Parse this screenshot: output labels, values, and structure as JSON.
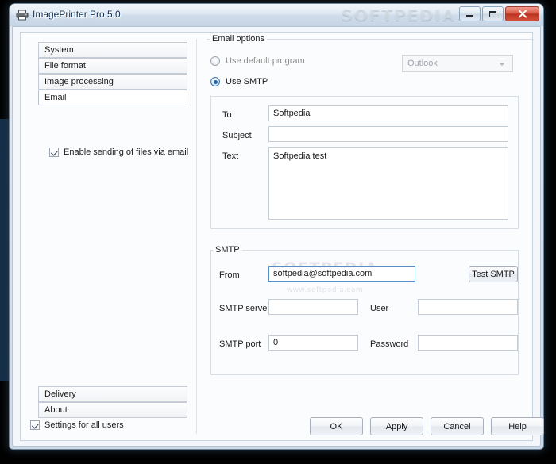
{
  "window": {
    "title": "ImagePrinter Pro 5.0",
    "icon": "printer-icon",
    "watermark": "SOFTPEDIA",
    "controls": {
      "minimize": "Minimize",
      "maximize": "Maximize",
      "close": "Close"
    }
  },
  "sidebar": {
    "items": [
      {
        "label": "System",
        "selected": false
      },
      {
        "label": "File format",
        "selected": false
      },
      {
        "label": "Image processing",
        "selected": false
      },
      {
        "label": "Email",
        "selected": true
      },
      {
        "label": "Delivery",
        "selected": false
      },
      {
        "label": "About",
        "selected": false
      }
    ],
    "enable_email": {
      "label": "Enable sending of files via email",
      "checked": true
    },
    "settings_all_users": {
      "label": "Settings for all users",
      "checked": true
    }
  },
  "email_options": {
    "group_label": "Email options",
    "use_default_program": {
      "label": "Use default program",
      "selected": false
    },
    "use_smtp": {
      "label": "Use SMTP",
      "selected": true
    },
    "program_combo": {
      "value": "Outlook",
      "disabled": true,
      "options": [
        "Outlook"
      ]
    },
    "message": {
      "to_label": "To",
      "to_value": "Softpedia",
      "to_placeholder": "",
      "subject_label": "Subject",
      "subject_value": "",
      "subject_placeholder": "",
      "text_label": "Text",
      "text_value": "Softpedia test",
      "text_placeholder": ""
    }
  },
  "smtp": {
    "group_label": "SMTP",
    "from_label": "From",
    "from_value": "softpedia@softpedia.com",
    "from_placeholder": "",
    "from_focused": true,
    "test_button": "Test SMTP",
    "server_label": "SMTP server",
    "server_value": "",
    "server_placeholder": "",
    "user_label": "User",
    "user_value": "",
    "user_placeholder": "",
    "port_label": "SMTP port",
    "port_value": "0",
    "port_placeholder": "",
    "password_label": "Password",
    "password_value": "",
    "password_placeholder": "",
    "watermark_main": "SOFTPEDIA",
    "watermark_sub": "www.softpedia.com"
  },
  "footer": {
    "ok": "OK",
    "apply": "Apply",
    "cancel": "Cancel",
    "help": "Help"
  },
  "colors": {
    "accent": "#1769bb",
    "focus_border": "#5b8ec4",
    "close_button": "#bc3320",
    "title_text": "#0d2f55"
  }
}
